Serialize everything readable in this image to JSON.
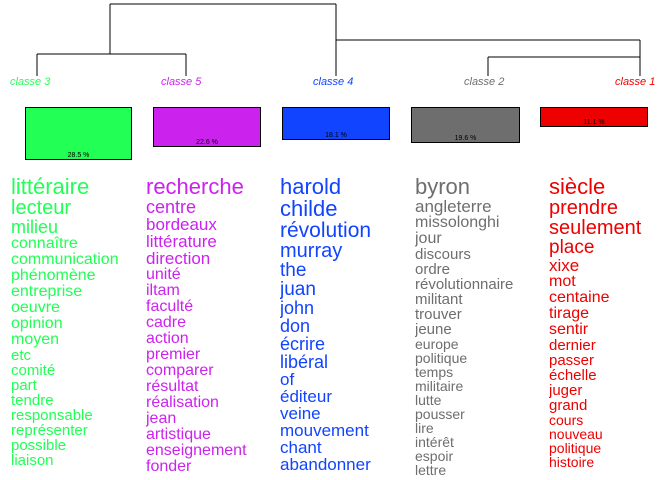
{
  "classes": [
    {
      "id": "c3",
      "label": "classe  3",
      "percent": "28.5 %",
      "color": "#22FF55",
      "words": [
        "littéraire",
        "lecteur",
        "milieu",
        "connaître",
        "communication",
        "phénomène",
        "entreprise",
        "oeuvre",
        "opinion",
        "moyen",
        "etc",
        "comité",
        "part",
        "tendre",
        "responsable",
        "représenter",
        "possible",
        "liaison"
      ]
    },
    {
      "id": "c5",
      "label": "classe  5",
      "percent": "22.6 %",
      "color": "#CC22EE",
      "words": [
        "recherche",
        "centre",
        "bordeaux",
        "littérature",
        "direction",
        "unité",
        "iltam",
        "faculté",
        "cadre",
        "action",
        "premier",
        "comparer",
        "résultat",
        "réalisation",
        "jean",
        "artistique",
        "enseignement",
        "fonder"
      ]
    },
    {
      "id": "c4",
      "label": "classe  4",
      "percent": "18.1 %",
      "color": "#1144FF",
      "words": [
        "harold",
        "childe",
        "révolution",
        "murray",
        "the",
        "juan",
        "john",
        "don",
        "écrire",
        "libéral",
        "of",
        "éditeur",
        "veine",
        "mouvement",
        "chant",
        "abandonner"
      ]
    },
    {
      "id": "c2",
      "label": "classe  2",
      "percent": "19.6 %",
      "color": "#6E6E6E",
      "words": [
        "byron",
        "angleterre",
        "missolonghi",
        "jour",
        "discours",
        "ordre",
        "révolutionnaire",
        "militant",
        "trouver",
        "jeune",
        "europe",
        "politique",
        "temps",
        "militaire",
        "lutte",
        "pousser",
        "lire",
        "intérêt",
        "espoir",
        "lettre"
      ]
    },
    {
      "id": "c1",
      "label": "classe  1",
      "percent": "11.1 %",
      "color": "#EE0000",
      "words": [
        "siècle",
        "prendre",
        "seulement",
        "place",
        "xixe",
        "mot",
        "centaine",
        "tirage",
        "sentir",
        "dernier",
        "passer",
        "échelle",
        "juger",
        "grand",
        "cours",
        "nouveau",
        "politique",
        "histoire"
      ]
    }
  ]
}
